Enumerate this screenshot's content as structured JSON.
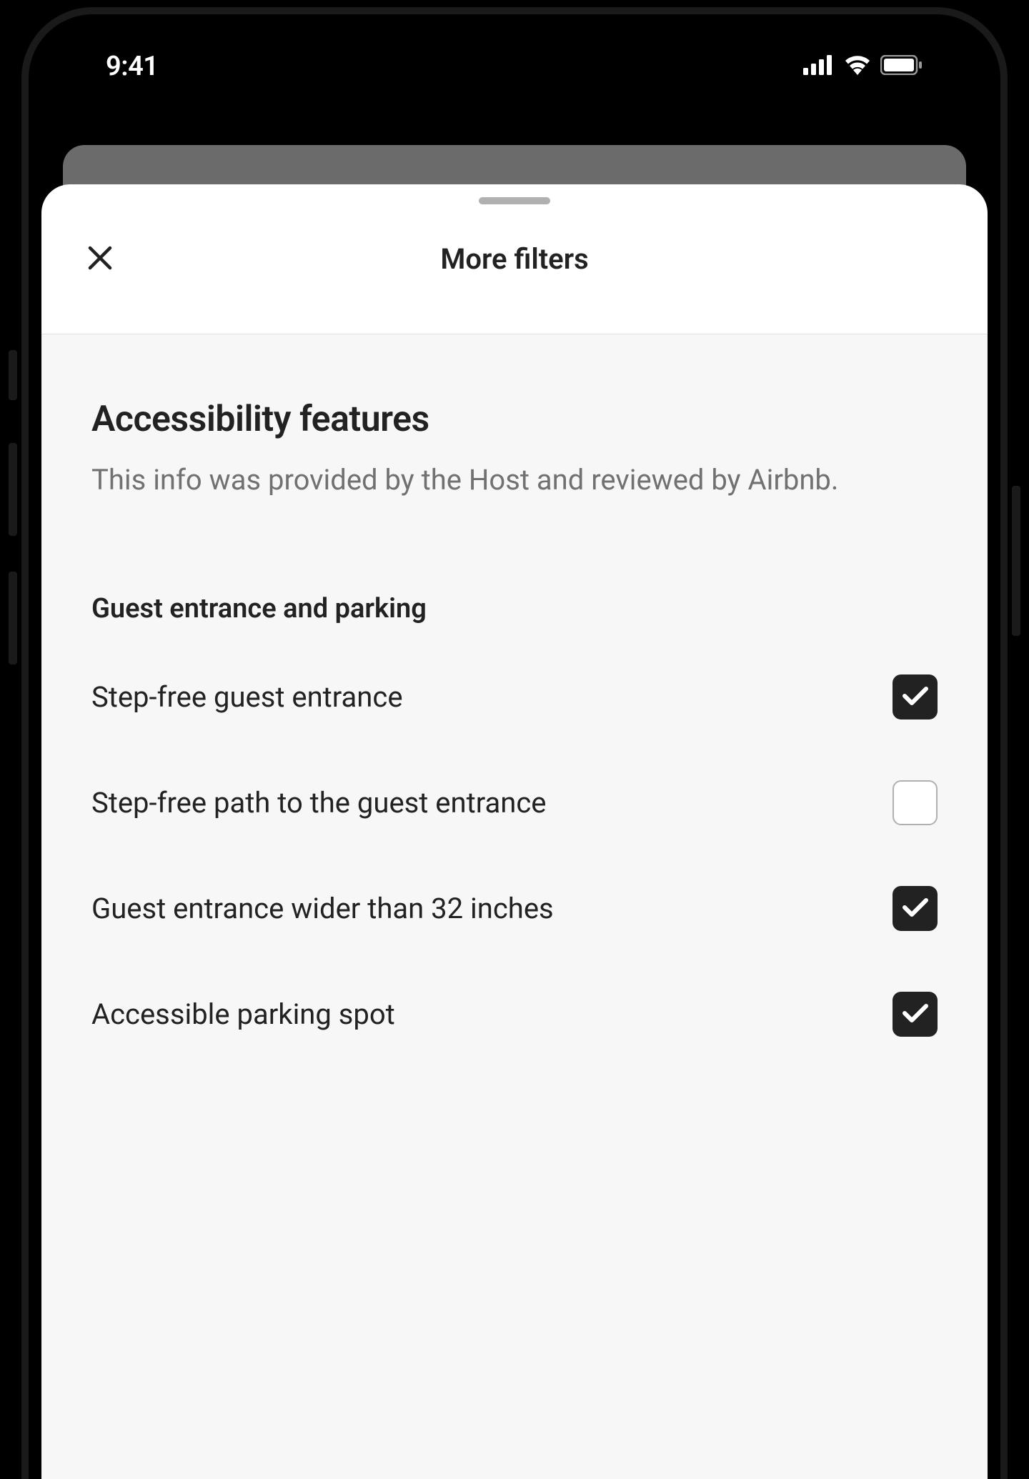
{
  "status": {
    "time": "9:41"
  },
  "modal": {
    "title": "More filters"
  },
  "section": {
    "title": "Accessibility features",
    "subtitle": "This info was provided by the Host and reviewed by Airbnb."
  },
  "subsection": {
    "title": "Guest entrance and parking",
    "filters": [
      {
        "label": "Step-free guest entrance",
        "checked": true
      },
      {
        "label": "Step-free path to the guest entrance",
        "checked": false
      },
      {
        "label": "Guest entrance wider than 32 inches",
        "checked": true
      },
      {
        "label": "Accessible parking spot",
        "checked": true
      }
    ]
  }
}
